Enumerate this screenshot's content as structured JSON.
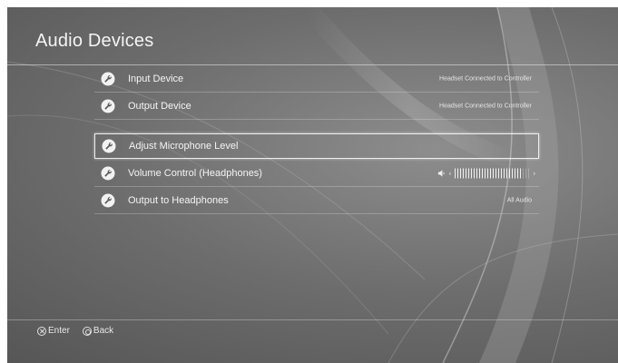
{
  "screen": {
    "title": "Audio Devices"
  },
  "menu": {
    "items": [
      {
        "label": "Input Device",
        "value": "Headset Connected to Controller"
      },
      {
        "label": "Output Device",
        "value": "Headset Connected to Controller"
      },
      {
        "label": "Adjust Microphone Level",
        "value": ""
      },
      {
        "label": "Volume Control (Headphones)",
        "value": ""
      },
      {
        "label": "Output to Headphones",
        "value": "All Audio"
      }
    ],
    "selected_index": 2,
    "volume": {
      "level": 0.9,
      "left_arrow": "‹",
      "right_arrow": "›"
    }
  },
  "footer": {
    "enter_label": "Enter",
    "back_label": "Back"
  },
  "icons": {
    "item_icon": "wrench-icon",
    "volume_icon": "speaker-icon",
    "enter_glyph": "cross-button-icon",
    "back_glyph": "circle-button-icon"
  },
  "colors": {
    "background": "#6d6d6d",
    "text": "#f2f2f2",
    "highlight_border": "#fafafa"
  }
}
